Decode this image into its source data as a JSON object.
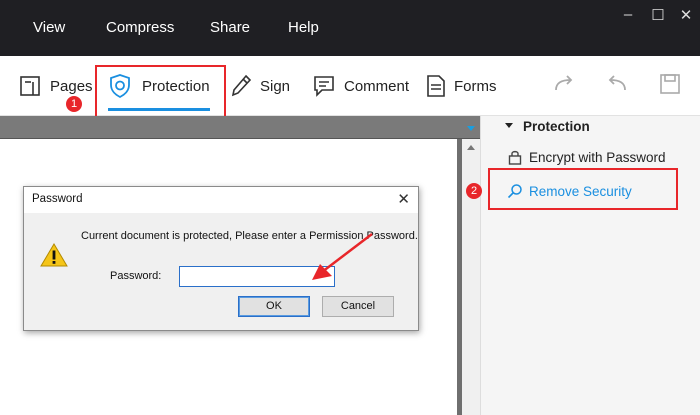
{
  "menubar": {
    "items": [
      "View",
      "Compress",
      "Share",
      "Help"
    ],
    "window_controls": [
      "minimize-icon",
      "maximize-icon",
      "close-icon"
    ]
  },
  "toolbar": {
    "tools": [
      {
        "label": "Pages",
        "icon": "pages-icon"
      },
      {
        "label": "Protection",
        "icon": "shield-icon"
      },
      {
        "label": "Sign",
        "icon": "pen-icon"
      },
      {
        "label": "Comment",
        "icon": "comment-icon"
      },
      {
        "label": "Forms",
        "icon": "form-icon"
      }
    ],
    "right_icons": [
      "redo-icon",
      "undo-icon",
      "save-icon"
    ],
    "active_tab": "Protection",
    "accent": "#1a8fe0"
  },
  "annotations": {
    "step1": "1",
    "step2": "2",
    "highlight_color": "#e8262a"
  },
  "panel": {
    "header": "Protection",
    "items": [
      {
        "label": "Encrypt with Password",
        "icon": "lock-icon"
      },
      {
        "label": "Remove Security",
        "icon": "search-icon",
        "color": "#1a8fe0"
      }
    ]
  },
  "dialog": {
    "title": "Password",
    "message": "Current document is protected, Please enter a Permission Password.",
    "field_label": "Password:",
    "field_value": "",
    "ok_label": "OK",
    "cancel_label": "Cancel",
    "icon": "warning-icon"
  }
}
